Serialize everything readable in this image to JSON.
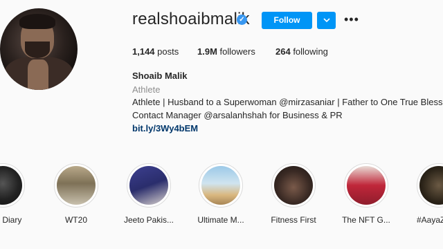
{
  "profile": {
    "username": "realshoaibmalik",
    "verified_icon": "verified-badge-icon",
    "follow_label": "Follow",
    "dropdown_icon": "chevron-down-icon",
    "more_icon": "more-horizontal-icon",
    "more_glyph": "•••",
    "posts_count": "1,144",
    "posts_label": " posts",
    "followers_count": "1.9M",
    "followers_label": " followers",
    "following_count": "264",
    "following_label": " following",
    "full_name": "Shoaib Malik",
    "category": "Athlete",
    "bio_line1": "Athlete | Husband to a Superwoman @mirzasaniar | Father to One True Blessing",
    "bio_line2": "Contact Manager @arsalanhshah for Business & PR",
    "link": "bit.ly/3Wy4bEM"
  },
  "colors": {
    "accent": "#0095f6",
    "verified": "#3897f0",
    "link": "#00376b",
    "muted": "#8e8e8e"
  },
  "highlights": [
    {
      "label": "y Diary"
    },
    {
      "label": "WT20"
    },
    {
      "label": "Jeeto Pakis..."
    },
    {
      "label": "Ultimate M..."
    },
    {
      "label": "Fitness First"
    },
    {
      "label": "The NFT G..."
    },
    {
      "label": "#AayaZ"
    }
  ]
}
